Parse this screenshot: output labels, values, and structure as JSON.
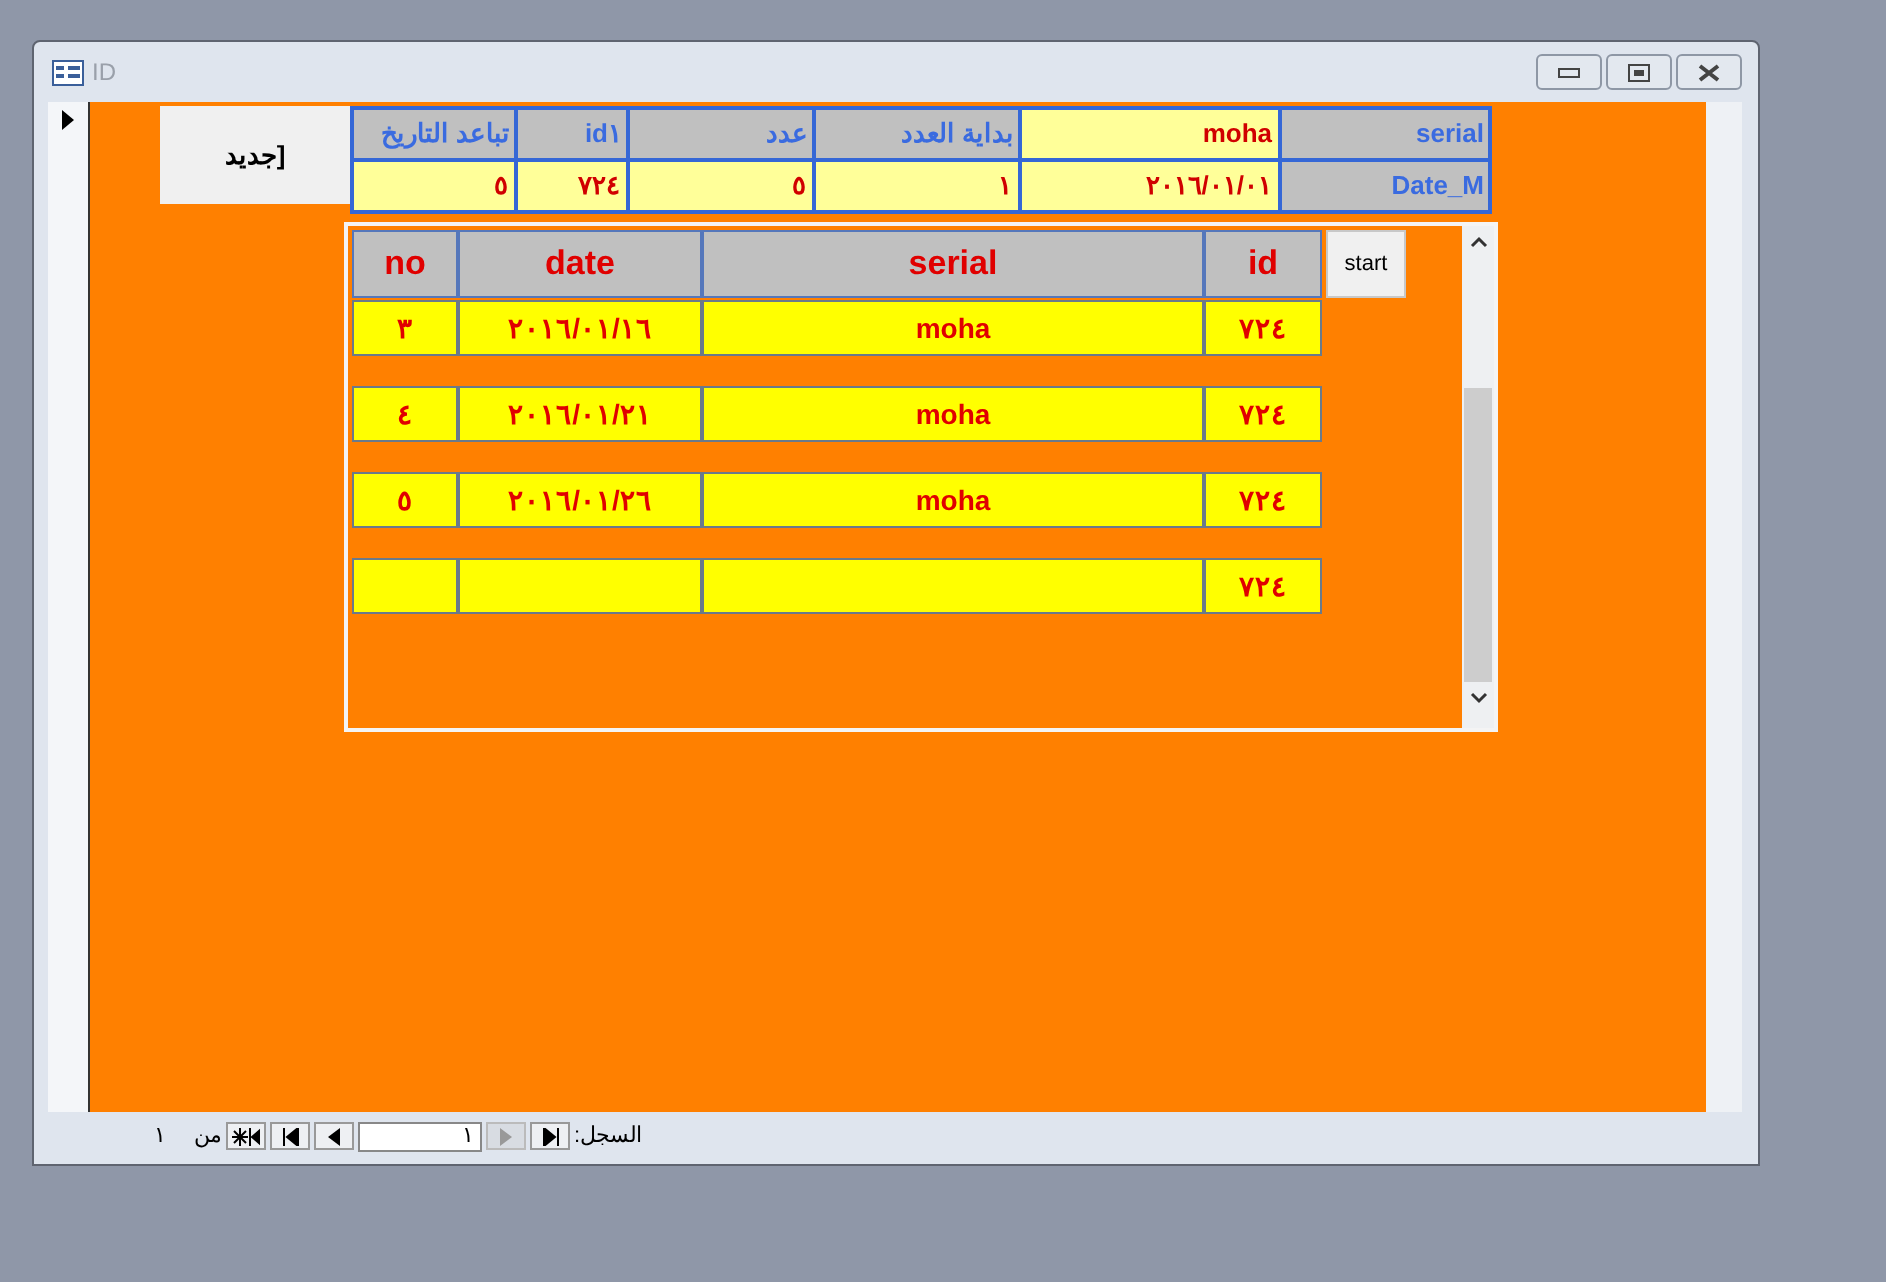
{
  "window": {
    "title": "ID"
  },
  "new_button": "جديد]",
  "top_grid": [
    [
      {
        "kind": "label",
        "text": "serial"
      },
      {
        "kind": "value",
        "text": "moha"
      },
      {
        "kind": "label",
        "text": "بداية العدد"
      },
      {
        "kind": "label",
        "text": "عدد"
      },
      {
        "kind": "label",
        "text": "id١"
      },
      {
        "kind": "label",
        "text": "تباعد التاريخ"
      }
    ],
    [
      {
        "kind": "label",
        "text": "Date_M"
      },
      {
        "kind": "value",
        "text": "٢٠١٦/٠١/٠١"
      },
      {
        "kind": "value",
        "text": "١"
      },
      {
        "kind": "value",
        "text": "٥"
      },
      {
        "kind": "value",
        "text": "٧٢٤"
      },
      {
        "kind": "value",
        "text": "٥"
      }
    ]
  ],
  "subform": {
    "columns": [
      "id",
      "serial",
      "date",
      "no"
    ],
    "start_button": "start",
    "rows": [
      {
        "no": "٣",
        "date": "٢٠١٦/٠١/١٦",
        "serial": "moha",
        "id": "٧٢٤"
      },
      {
        "no": "٤",
        "date": "٢٠١٦/٠١/٢١",
        "serial": "moha",
        "id": "٧٢٤"
      },
      {
        "no": "٥",
        "date": "٢٠١٦/٠١/٢٦",
        "serial": "moha",
        "id": "٧٢٤"
      },
      {
        "id": "٧٢٤"
      }
    ]
  },
  "navigation": {
    "label": "السجل:",
    "current": "١",
    "of": "من",
    "total": "١"
  }
}
